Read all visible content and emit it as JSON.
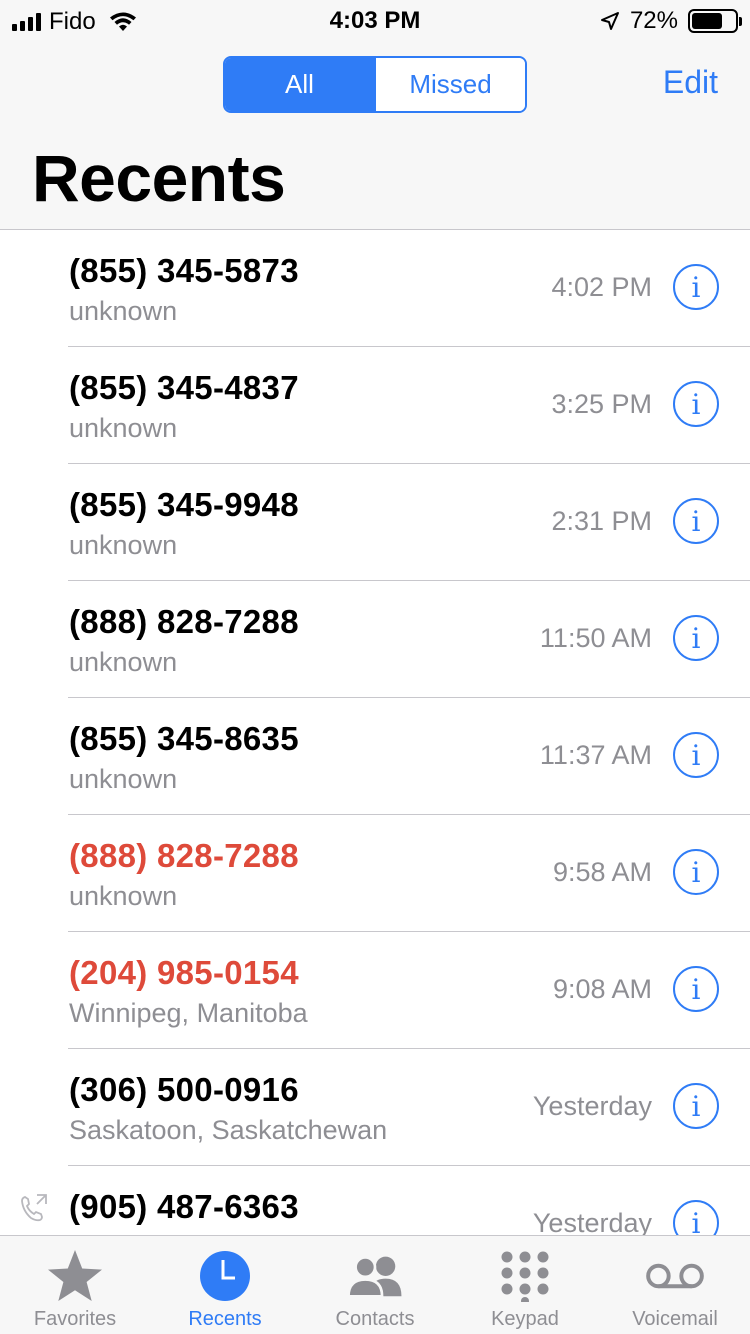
{
  "status_bar": {
    "carrier": "Fido",
    "time": "4:03 PM",
    "battery_percent": "72%",
    "battery_level": 0.72
  },
  "header": {
    "segments": [
      "All",
      "Missed"
    ],
    "selected_segment": "All",
    "edit_label": "Edit",
    "title": "Recents"
  },
  "calls": [
    {
      "number": "(855) 345-5873",
      "subtitle": "unknown",
      "time": "4:02 PM",
      "missed": false
    },
    {
      "number": "(855) 345-4837",
      "subtitle": "unknown",
      "time": "3:25 PM",
      "missed": false
    },
    {
      "number": "(855) 345-9948",
      "subtitle": "unknown",
      "time": "2:31 PM",
      "missed": false
    },
    {
      "number": "(888) 828-7288",
      "subtitle": "unknown",
      "time": "11:50 AM",
      "missed": false
    },
    {
      "number": "(855) 345-8635",
      "subtitle": "unknown",
      "time": "11:37 AM",
      "missed": false
    },
    {
      "number": "(888) 828-7288",
      "subtitle": "unknown",
      "time": "9:58 AM",
      "missed": true
    },
    {
      "number": "(204) 985-0154",
      "subtitle": "Winnipeg, Manitoba",
      "time": "9:08 AM",
      "missed": true
    },
    {
      "number": "(306) 500-0916",
      "subtitle": "Saskatoon, Saskatchewan",
      "time": "Yesterday",
      "missed": false
    },
    {
      "number": "(905) 487-6363",
      "subtitle": "",
      "time": "Yesterday",
      "missed": false,
      "outgoing": true
    }
  ],
  "tabs": [
    {
      "label": "Favorites",
      "icon": "star-icon"
    },
    {
      "label": "Recents",
      "icon": "clock-icon",
      "active": true
    },
    {
      "label": "Contacts",
      "icon": "contacts-icon"
    },
    {
      "label": "Keypad",
      "icon": "keypad-icon"
    },
    {
      "label": "Voicemail",
      "icon": "voicemail-icon"
    }
  ],
  "colors": {
    "accent": "#2f7cf6",
    "missed": "#de4a3a",
    "secondary_text": "#8e8e93"
  }
}
